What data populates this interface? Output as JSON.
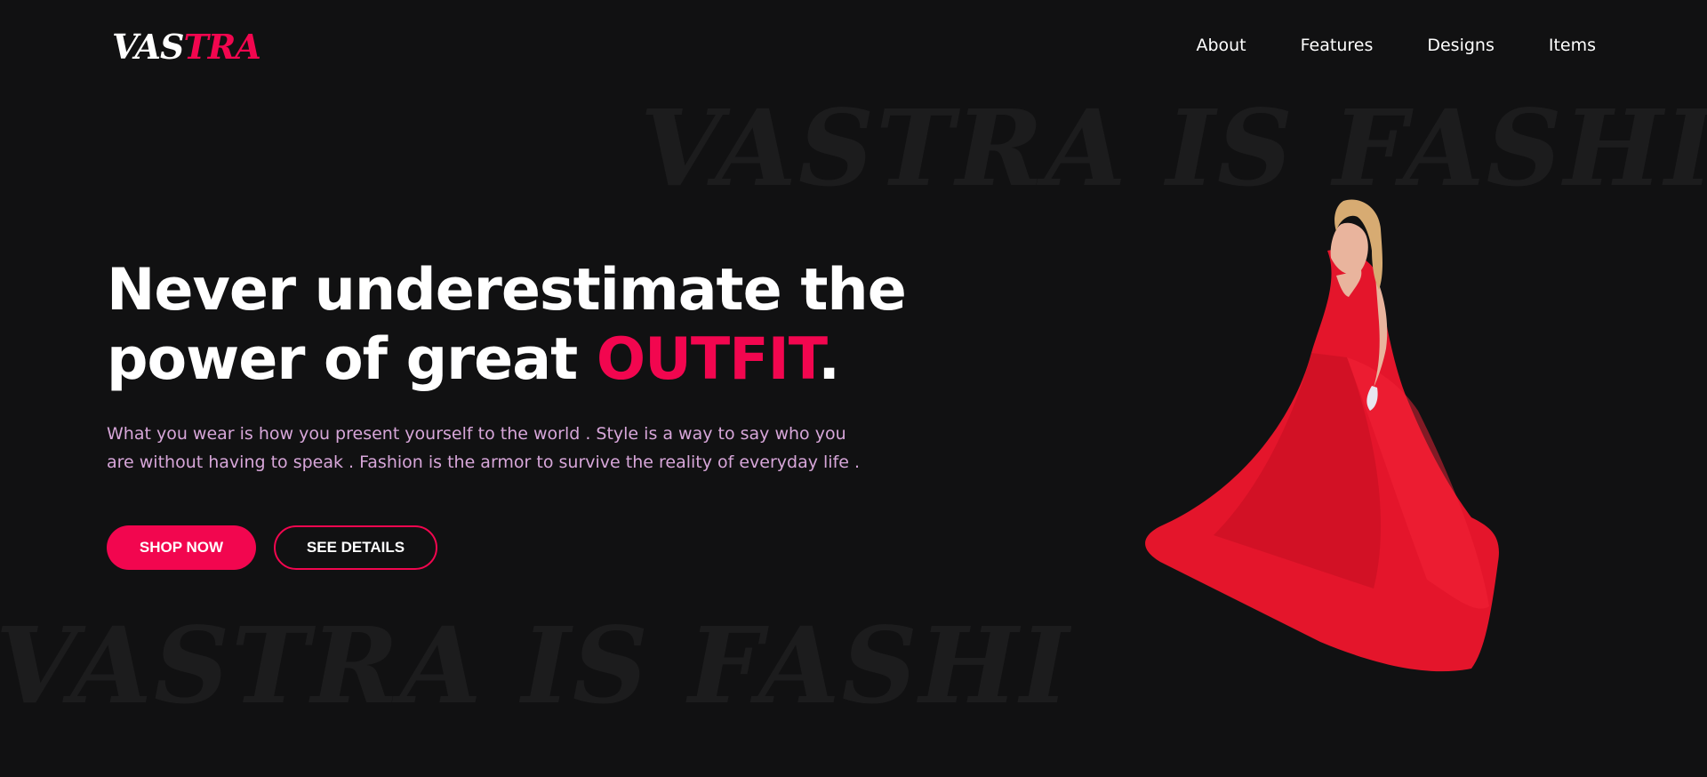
{
  "background_watermark": "VASTRA IS FASHION",
  "logo": {
    "part1": "VAS",
    "part2": "TRA"
  },
  "nav": {
    "items": [
      "About",
      "Features",
      "Designs",
      "Items"
    ]
  },
  "hero": {
    "title_line1": "Never underestimate the",
    "title_line2_prefix": "power of great ",
    "title_accent": "OUTFIT",
    "title_suffix": ".",
    "description_line1": "What you wear is how you present yourself to the world . Style is a way to say who you",
    "description_line2": "are without having to speak . Fashion is the armor to survive the reality of everyday life .",
    "primary_button": "SHOP NOW",
    "secondary_button": "SEE DETAILS"
  },
  "colors": {
    "background": "#111112",
    "accent": "#f2064f",
    "description_text": "#d7a6d9",
    "watermark": "#1c1c1d"
  },
  "image": {
    "icon": "model-in-red-dress-image"
  }
}
